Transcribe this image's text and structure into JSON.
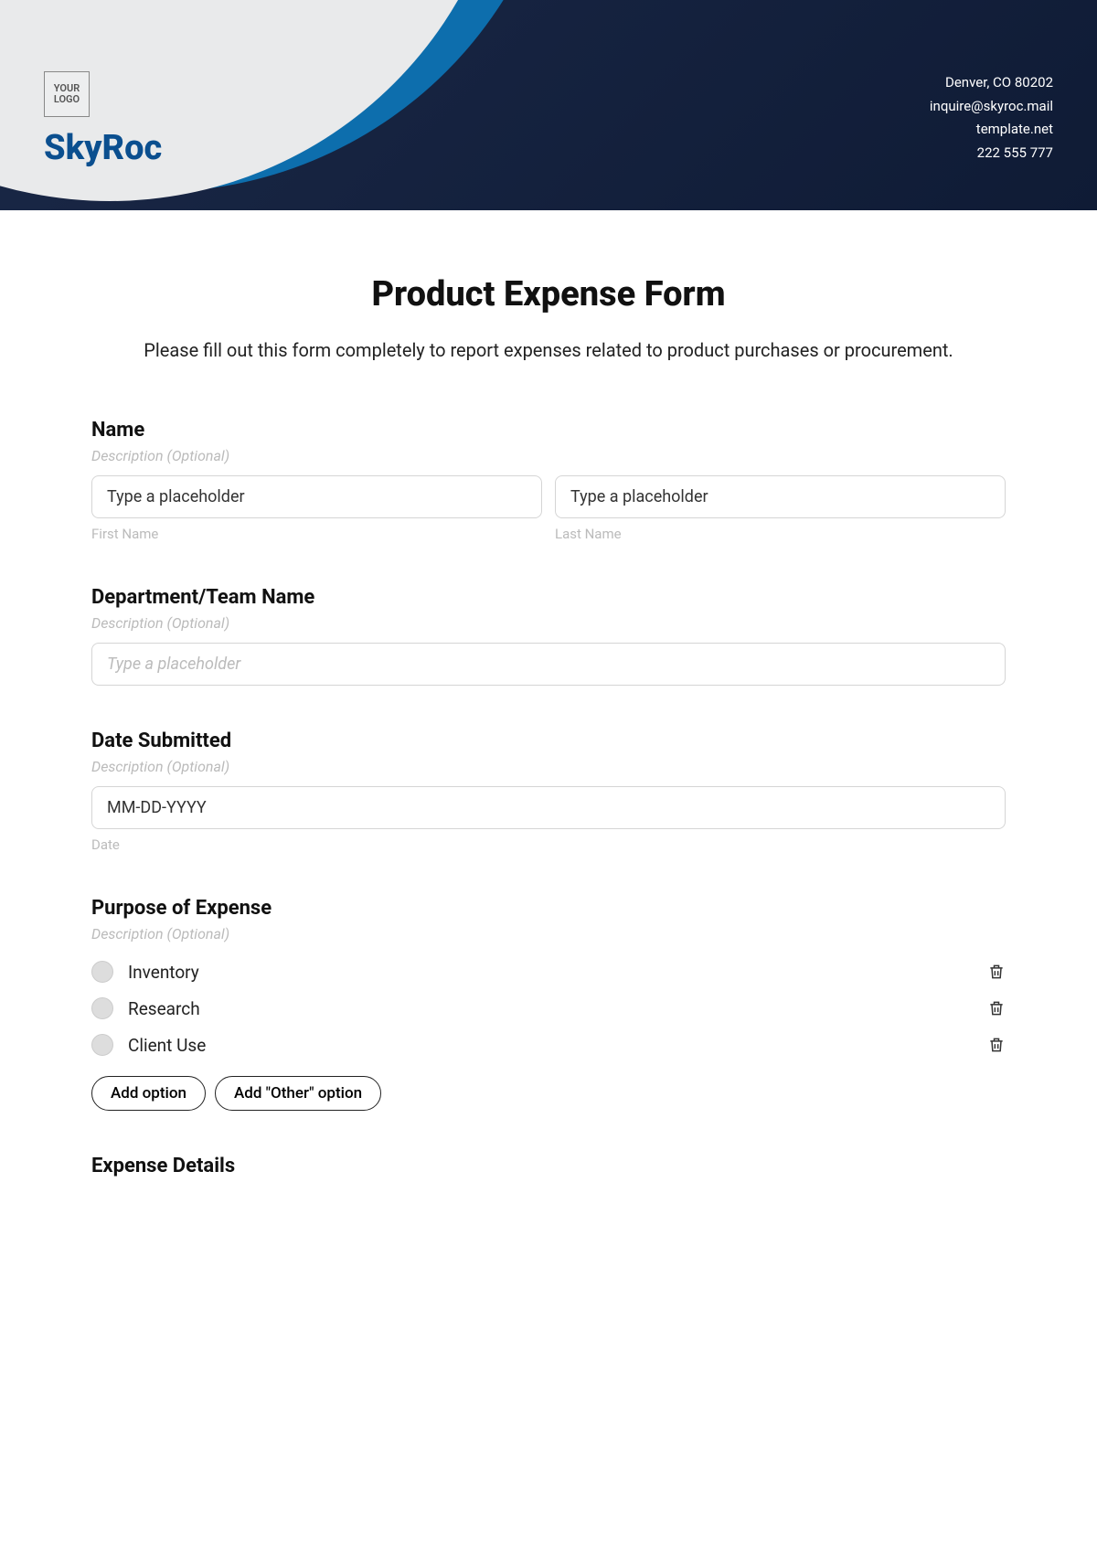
{
  "header": {
    "logo_text": "YOUR LOGO",
    "company": "SkyRoc",
    "address": "Denver, CO 80202",
    "email": "inquire@skyroc.mail",
    "site": "template.net",
    "phone": "222 555 777"
  },
  "form": {
    "title": "Product Expense Form",
    "description": "Please fill out this form completely to report expenses related to product purchases or procurement."
  },
  "name": {
    "label": "Name",
    "sub": "Description (Optional)",
    "first_placeholder": "Type a placeholder",
    "last_placeholder": "Type a placeholder",
    "first_caption": "First Name",
    "last_caption": "Last Name"
  },
  "department": {
    "label": "Department/Team Name",
    "sub": "Description (Optional)",
    "placeholder": "Type a placeholder"
  },
  "date": {
    "label": "Date Submitted",
    "sub": "Description (Optional)",
    "placeholder": "MM-DD-YYYY",
    "caption": "Date"
  },
  "purpose": {
    "label": "Purpose of Expense",
    "sub": "Description (Optional)",
    "options": [
      "Inventory",
      "Research",
      "Client Use"
    ],
    "add_option": "Add option",
    "add_other": "Add \"Other\" option"
  },
  "expense": {
    "label": "Expense Details"
  }
}
